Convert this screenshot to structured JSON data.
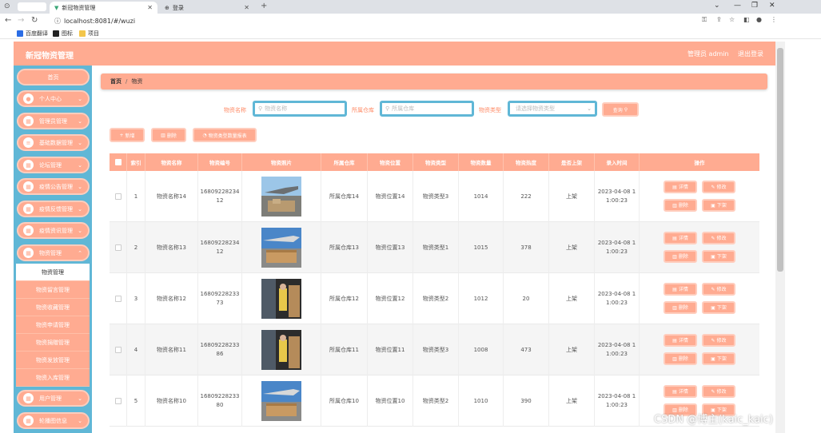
{
  "browser": {
    "tabs": [
      {
        "title": "新冠物资管理",
        "active": true
      },
      {
        "title": "登录",
        "active": false
      }
    ],
    "url": "localhost:8081/#/wuzi",
    "bookmarks": [
      "百度翻译",
      "图标",
      "项目"
    ]
  },
  "header": {
    "title": "新冠物资管理",
    "user": "管理员 admin",
    "logout": "退出登录"
  },
  "sidebar": {
    "home": "首页",
    "items": [
      {
        "label": "个人中心",
        "icon": "user-icon"
      },
      {
        "label": "管理员管理",
        "icon": "grid-icon"
      },
      {
        "label": "基础数据管理",
        "icon": "list-icon"
      },
      {
        "label": "论坛管理",
        "icon": "grid-icon"
      },
      {
        "label": "疫情公告管理",
        "icon": "grid-icon"
      },
      {
        "label": "疫情反馈管理",
        "icon": "grid-icon"
      },
      {
        "label": "疫情资讯管理",
        "icon": "grid-icon"
      },
      {
        "label": "物资管理",
        "icon": "grid-icon",
        "expanded": true
      }
    ],
    "subitems": [
      {
        "label": "物资管理",
        "active": true
      },
      {
        "label": "物资留言管理",
        "active": false
      },
      {
        "label": "物资收藏管理",
        "active": false
      },
      {
        "label": "物资申请管理",
        "active": false
      },
      {
        "label": "物资捐赠管理",
        "active": false
      },
      {
        "label": "物资发放管理",
        "active": false
      },
      {
        "label": "物资入库管理",
        "active": false
      }
    ],
    "after": [
      {
        "label": "用户管理",
        "icon": "grid-icon"
      },
      {
        "label": "轮播图信息",
        "icon": "grid-icon"
      }
    ]
  },
  "breadcrumb": {
    "home": "首页",
    "separator": "/",
    "current": "物资"
  },
  "filters": {
    "name_label": "物资名称",
    "name_placeholder": "物资名称",
    "warehouse_label": "所属仓库",
    "warehouse_placeholder": "所属仓库",
    "type_label": "物资类型",
    "type_placeholder": "请选择物资类型",
    "query_button": "查询"
  },
  "actions": {
    "add": "新增",
    "delete": "删除",
    "chart": "物资类型数量报表"
  },
  "table": {
    "columns": [
      "索引",
      "物资名称",
      "物资编号",
      "物资照片",
      "所属仓库",
      "物资位置",
      "物资类型",
      "物资数量",
      "物资热度",
      "是否上架",
      "录入时间",
      "操作"
    ],
    "rows": [
      {
        "index": "1",
        "name": "物资名称14",
        "code1": "16809228234",
        "code2": "12",
        "warehouse": "所属仓库14",
        "location": "物资位置14",
        "type": "物资类型3",
        "quantity": "1014",
        "heat": "222",
        "onshelf": "上架",
        "time1": "2023-04-08 1",
        "time2": "1:00:23",
        "photo": "plane"
      },
      {
        "index": "2",
        "name": "物资名称13",
        "code1": "16809228234",
        "code2": "12",
        "warehouse": "所属仓库13",
        "location": "物资位置13",
        "type": "物资类型1",
        "quantity": "1015",
        "heat": "378",
        "onshelf": "上架",
        "time1": "2023-04-08 1",
        "time2": "1:00:23",
        "photo": "cargo"
      },
      {
        "index": "3",
        "name": "物资名称12",
        "code1": "16809228233",
        "code2": "73",
        "warehouse": "所属仓库12",
        "location": "物资位置12",
        "type": "物资类型2",
        "quantity": "1012",
        "heat": "20",
        "onshelf": "上架",
        "time1": "2023-04-08 1",
        "time2": "1:00:23",
        "photo": "loading"
      },
      {
        "index": "4",
        "name": "物资名称11",
        "code1": "16809228233",
        "code2": "86",
        "warehouse": "所属仓库11",
        "location": "物资位置11",
        "type": "物资类型3",
        "quantity": "1008",
        "heat": "473",
        "onshelf": "上架",
        "time1": "2023-04-08 1",
        "time2": "1:00:23",
        "photo": "loading"
      },
      {
        "index": "5",
        "name": "物资名称10",
        "code1": "16809228233",
        "code2": "80",
        "warehouse": "所属仓库10",
        "location": "物资位置10",
        "type": "物资类型2",
        "quantity": "1010",
        "heat": "390",
        "onshelf": "上架",
        "time1": "2023-04-08 1",
        "time2": "1:00:23",
        "photo": "cargo"
      }
    ],
    "row_buttons": {
      "detail": "详情",
      "edit": "修改",
      "delete": "删除",
      "offshelf": "下架"
    }
  },
  "watermark": "CSDN @博主(kaic_kaic)",
  "colors": {
    "accent": "#ffab91",
    "sidebar": "#60b7d6"
  }
}
